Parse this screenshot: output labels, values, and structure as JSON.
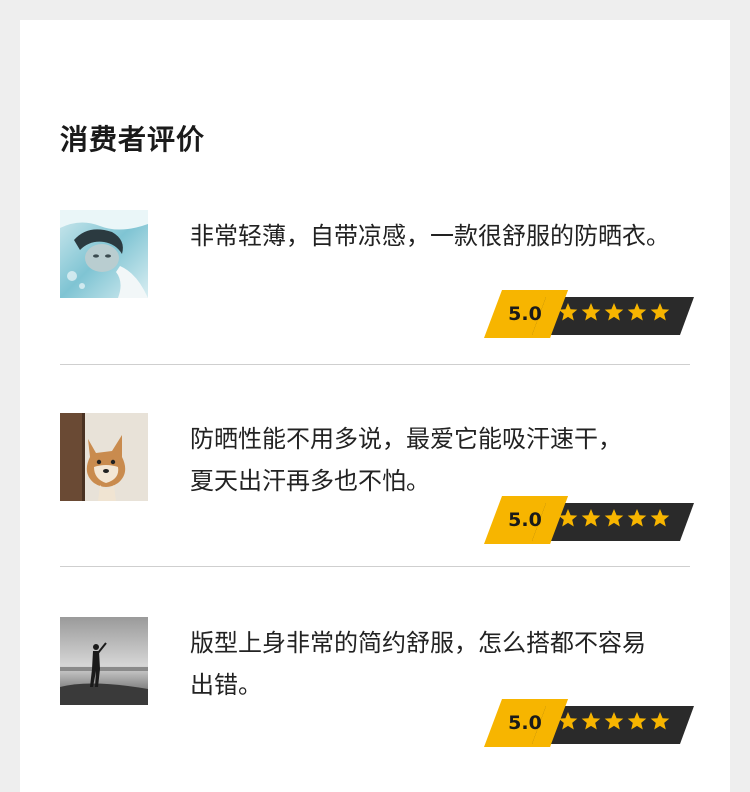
{
  "section": {
    "title": "消费者评价"
  },
  "colors": {
    "badge_yellow": "#f7b500",
    "badge_dark": "#2a2a2a",
    "star": "#f7b500",
    "divider": "#cfcfcf"
  },
  "reviews": [
    {
      "avatar_icon": "underwater-portrait-avatar",
      "lines": [
        "非常轻薄，自带凉感，一款很舒服的防晒衣。"
      ],
      "score": "5.0",
      "stars": 5
    },
    {
      "avatar_icon": "shiba-dog-avatar",
      "lines": [
        "防晒性能不用多说，最爱它能吸汗速干，",
        "夏天出汗再多也不怕。"
      ],
      "score": "5.0",
      "stars": 5
    },
    {
      "avatar_icon": "person-on-beach-avatar",
      "lines": [
        "版型上身非常的简约舒服，怎么搭都不容易",
        "出错。"
      ],
      "score": "5.0",
      "stars": 5
    }
  ]
}
